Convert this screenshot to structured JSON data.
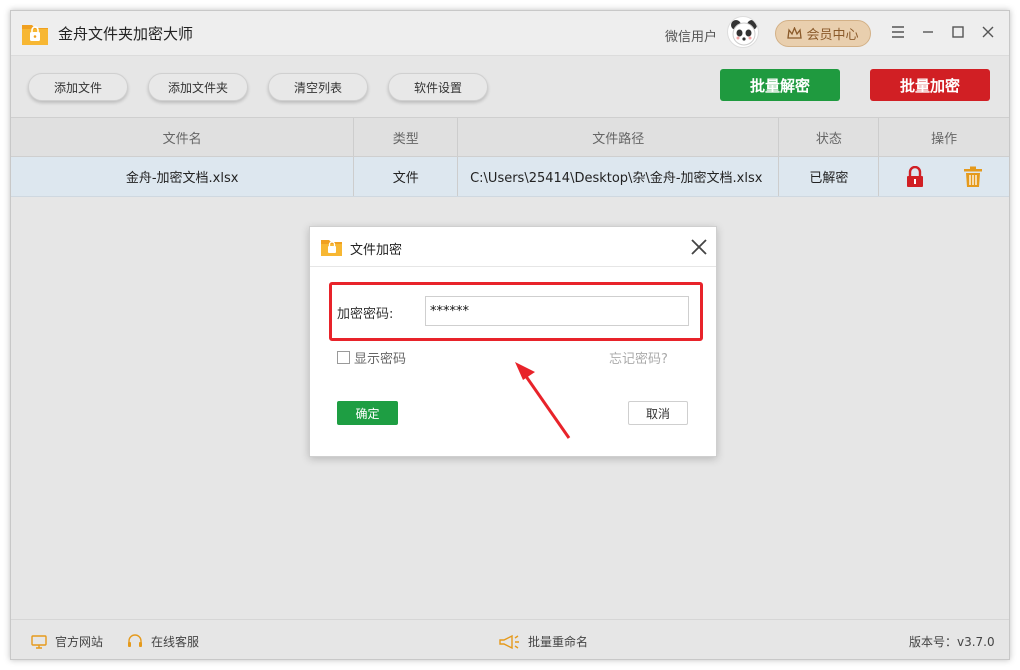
{
  "app": {
    "title": "金舟文件夹加密大师",
    "user_name": "微信用户",
    "vip_label": "会员中心"
  },
  "toolbar": {
    "add_file": "添加文件",
    "add_folder": "添加文件夹",
    "clear_list": "清空列表",
    "settings": "软件设置",
    "batch_decrypt": "批量解密",
    "batch_encrypt": "批量加密"
  },
  "table": {
    "headers": [
      "文件名",
      "类型",
      "文件路径",
      "状态",
      "操作"
    ],
    "rows": [
      {
        "name": "金舟-加密文档.xlsx",
        "type": "文件",
        "path": "C:\\Users\\25414\\Desktop\\杂\\金舟-加密文档.xlsx",
        "status": "已解密"
      }
    ]
  },
  "dialog": {
    "title": "文件加密",
    "password_label": "加密密码:",
    "password_value": "******",
    "show_password": "显示密码",
    "forgot_password": "忘记密码?",
    "ok": "确定",
    "cancel": "取消"
  },
  "statusbar": {
    "website": "官方网站",
    "support": "在线客服",
    "batch_rename": "批量重命名",
    "version": "版本号：v3.7.0"
  },
  "colors": {
    "green": "#1f9a3f",
    "red": "#d11f24",
    "highlight": "#e8232a"
  },
  "icons": [
    "folder-lock-icon",
    "panda-avatar-icon",
    "crown-icon",
    "menu-icon",
    "minimize-icon",
    "maximize-icon",
    "close-icon",
    "lock-icon",
    "trash-icon",
    "monitor-icon",
    "headset-icon",
    "megaphone-icon"
  ]
}
